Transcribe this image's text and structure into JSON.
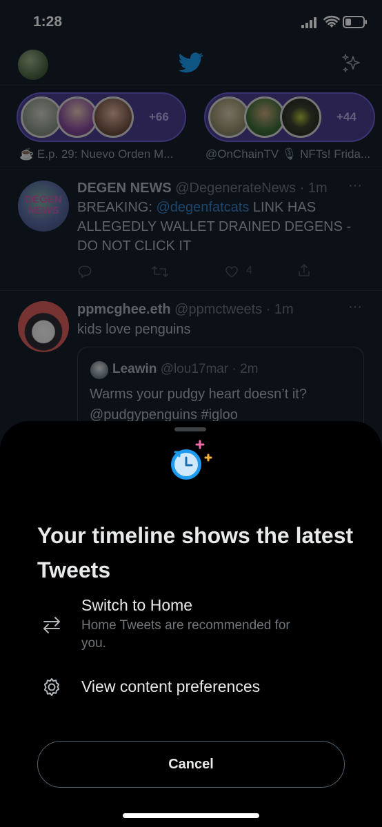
{
  "status_bar": {
    "time": "1:28"
  },
  "spaces": [
    {
      "count": "+66",
      "label": "☕ E.p. 29: Nuevo Orden M..."
    },
    {
      "count": "+44",
      "label": "@OnChainTV 🎙 NFTs! Frida..."
    }
  ],
  "tweets": [
    {
      "name": "DEGEN NEWS",
      "handle": "@DegenerateNews · 1m",
      "text_prefix": "BREAKING: ",
      "mention": "@degenfatcats",
      "text_suffix": " LINK HAS ALLEGEDLY WALLET DRAINED DEGENS - DO NOT CLICK IT",
      "like_count": "4",
      "avatar_text": "DEGEN NEWS"
    },
    {
      "name": "ppmcghee.eth",
      "handle": "@ppmctweets · 1m",
      "text": "kids love penguins",
      "quote": {
        "name": "Leawin",
        "handle": "@lou17mar · 2m",
        "text": "Warms your pudgy heart doesn’t it? @pudgypenguins #igloo"
      }
    }
  ],
  "sheet": {
    "title": "Your timeline shows the latest Tweets",
    "options": [
      {
        "title": "Switch to Home",
        "subtitle": "Home Tweets are recommended for you.",
        "icon": "swap-arrows-icon"
      },
      {
        "title": "View content preferences",
        "icon": "gear-icon"
      }
    ],
    "cancel_label": "Cancel"
  },
  "colors": {
    "accent": "#1d9bf0",
    "space_bg": "#4c3f91",
    "background": "#15202b"
  }
}
